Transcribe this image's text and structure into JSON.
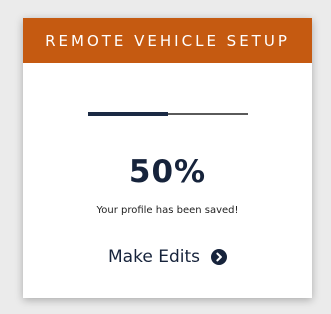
{
  "card": {
    "title": "REMOTE VEHICLE SETUP",
    "progress": {
      "value": 0.5,
      "label": "50%"
    },
    "message": "Your profile has been saved!",
    "edit_link": {
      "label": "Make Edits",
      "icon": "chevron-right-circle-icon"
    }
  },
  "colors": {
    "header_bg": "#c55a11",
    "header_text": "#ffffff",
    "primary_dark": "#16233b",
    "progress_track": "#5a5a5a",
    "page_bg": "#ebebeb"
  }
}
